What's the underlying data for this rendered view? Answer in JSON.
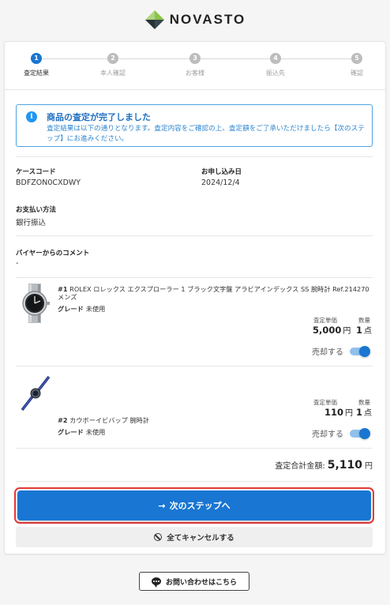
{
  "brand": {
    "name": "NOVASTO"
  },
  "steps": [
    {
      "num": "1",
      "label": "査定結果",
      "active": true
    },
    {
      "num": "2",
      "label": "本人確認",
      "active": false
    },
    {
      "num": "3",
      "label": "お客様",
      "active": false
    },
    {
      "num": "4",
      "label": "振込先",
      "active": false
    },
    {
      "num": "5",
      "label": "確認",
      "active": false
    }
  ],
  "notice": {
    "icon": "info-icon",
    "title": "商品の査定が完了しました",
    "body": "査定結果は以下の通りとなります。査定内容をご確認の上、査定額をご了承いただけましたら【次のステップ】にお進みください。"
  },
  "case_code": {
    "label": "ケースコード",
    "value": "BDFZON0CXDWY"
  },
  "apply_date": {
    "label": "お申し込み日",
    "value": "2024/12/4"
  },
  "payment": {
    "label": "お支払い方法",
    "value": "銀行振込"
  },
  "buyer_comment": {
    "label": "バイヤーからのコメント",
    "value": "-"
  },
  "items": [
    {
      "num": "#1",
      "title": "ROLEX ロレックス エクスプローラー 1 ブラック文字盤 アラビアインデックス SS 腕時計 Ref.214270 メンズ",
      "grade_label": "グレード",
      "grade": "未使用",
      "unit_price_label": "査定単価",
      "qty_label": "数量",
      "price": "5,000",
      "price_unit": "円",
      "qty": "1",
      "qty_unit": "点",
      "sell_label": "売却する",
      "sell": true
    },
    {
      "num": "#2",
      "title": "カウボーイビバップ 腕時計",
      "grade_label": "グレード",
      "grade": "未使用",
      "unit_price_label": "査定単価",
      "qty_label": "数量",
      "price": "110",
      "price_unit": "円",
      "qty": "1",
      "qty_unit": "点",
      "sell_label": "売却する",
      "sell": true
    }
  ],
  "total": {
    "label": "査定合計金額:",
    "amount": "5,110",
    "unit": "円"
  },
  "buttons": {
    "next": "次のステップへ",
    "next_icon": "arrow-right-icon",
    "cancel": "全てキャンセルする",
    "cancel_icon": "ban-icon",
    "contact": "お問い合わせはこちら",
    "contact_icon": "chat-icon"
  },
  "colors": {
    "primary": "#1976d2",
    "highlight": "#e53935",
    "info_border": "#4fa3e0"
  }
}
